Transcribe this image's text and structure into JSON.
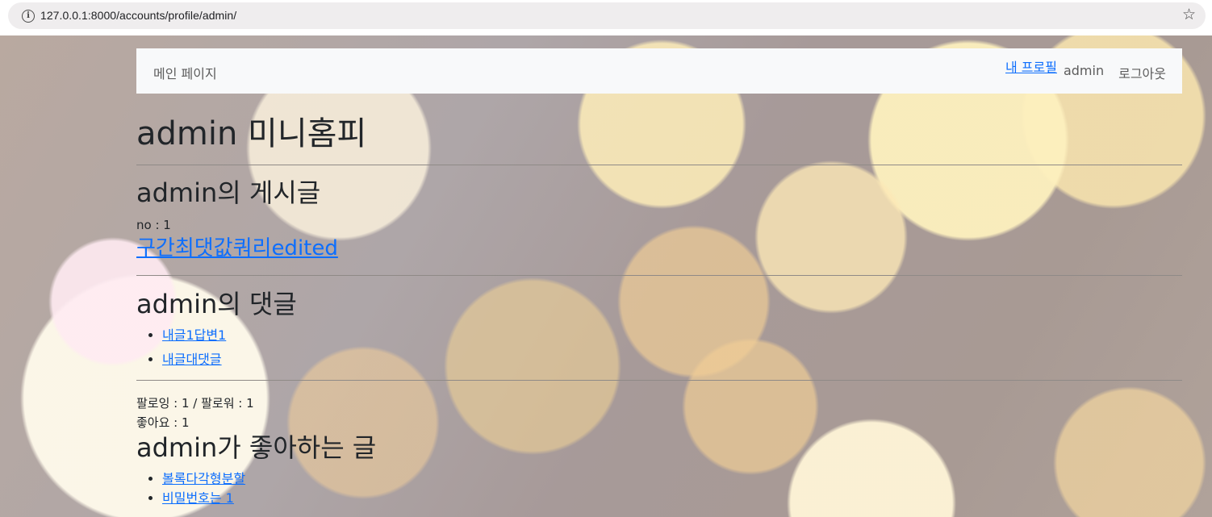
{
  "browser": {
    "url": "127.0.0.1:8000/accounts/profile/admin/",
    "site_info_glyph": "i",
    "bookmark_glyph": "☆"
  },
  "navbar": {
    "brand": "메인 페이지",
    "my_profile": "내 프로필",
    "username": "admin",
    "logout": "로그아웃"
  },
  "profile": {
    "title": "admin 미니홈피",
    "posts_title": "admin의 게시글",
    "posts": [
      {
        "no_label": "no : 1",
        "title": "구간최댓값쿼리edited"
      }
    ],
    "comments_title": "admin의 댓글",
    "comments": [
      "내글1답변1",
      "내글대댓글"
    ],
    "follow_line": "팔로잉 : 1 / 팔로워 : 1",
    "likes_line": "좋아요 : 1",
    "liked_title": "admin가 좋아하는 글",
    "liked_posts": [
      "볼록다각형분할",
      "비밀번호는 1"
    ]
  },
  "colors": {
    "link": "#0d6efd",
    "navbar_bg": "#f8f9fa",
    "text": "#212529"
  }
}
